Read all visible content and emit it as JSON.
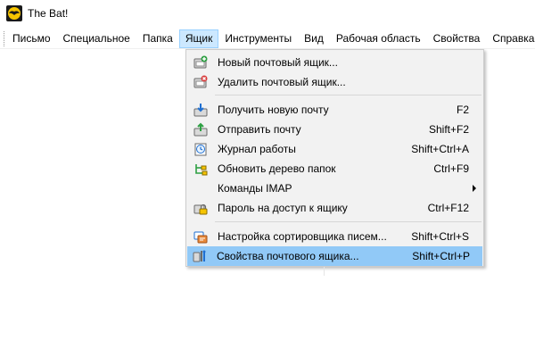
{
  "window": {
    "title": "The Bat!",
    "app_icon": "the-bat-logo-icon"
  },
  "menubar": {
    "items": [
      {
        "label": "Письмо"
      },
      {
        "label": "Специальное"
      },
      {
        "label": "Папка"
      },
      {
        "label": "Ящик",
        "active": true
      },
      {
        "label": "Инструменты"
      },
      {
        "label": "Вид"
      },
      {
        "label": "Рабочая область"
      },
      {
        "label": "Свойства"
      },
      {
        "label": "Справка"
      }
    ]
  },
  "dropdown": {
    "groups": [
      [
        {
          "label": "Новый почтовый ящик...",
          "shortcut": "",
          "icon": "new-mailbox-icon"
        },
        {
          "label": "Удалить почтовый ящик...",
          "shortcut": "",
          "icon": "delete-mailbox-icon"
        }
      ],
      [
        {
          "label": "Получить новую почту",
          "shortcut": "F2",
          "icon": "get-mail-icon"
        },
        {
          "label": "Отправить почту",
          "shortcut": "Shift+F2",
          "icon": "send-mail-icon"
        },
        {
          "label": "Журнал работы",
          "shortcut": "Shift+Ctrl+A",
          "icon": "log-icon"
        },
        {
          "label": "Обновить дерево папок",
          "shortcut": "Ctrl+F9",
          "icon": "refresh-tree-icon"
        },
        {
          "label": "Команды IMAP",
          "shortcut": "",
          "icon": "",
          "submenu": true
        },
        {
          "label": "Пароль на доступ к ящику",
          "shortcut": "Ctrl+F12",
          "icon": "lock-icon"
        }
      ],
      [
        {
          "label": "Настройка сортировщика писем...",
          "shortcut": "Shift+Ctrl+S",
          "icon": "sorter-icon"
        },
        {
          "label": "Свойства почтового ящика...",
          "shortcut": "Shift+Ctrl+P",
          "icon": "mailbox-properties-icon",
          "highlighted": true
        }
      ]
    ]
  },
  "colors": {
    "menu_active_bg": "#cce8ff",
    "menu_highlight_bg": "#91c9f7",
    "dropdown_bg": "#f2f2f2"
  }
}
